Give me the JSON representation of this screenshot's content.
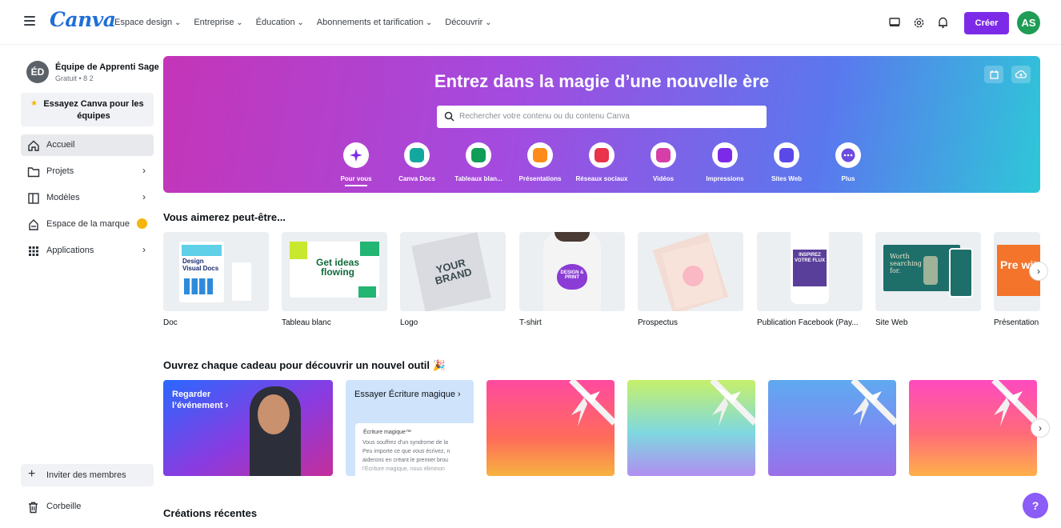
{
  "topbar": {
    "logo": "Canva",
    "nav": [
      "Espace design",
      "Entreprise",
      "Éducation",
      "Abonnements et tarification",
      "Découvrir"
    ],
    "create_label": "Créer",
    "avatar_initials": "AS",
    "icons": [
      "monitor-icon",
      "gear-icon",
      "bell-icon"
    ]
  },
  "sidebar": {
    "team_initials": "ÉD",
    "team_name": "Équipe de Apprenti Sage",
    "team_sub": "Gratuit • 8 2",
    "try_text": "Essayez Canva pour les équipes",
    "items": [
      {
        "label": "Accueil"
      },
      {
        "label": "Projets"
      },
      {
        "label": "Modèles"
      },
      {
        "label": "Espace de la marque"
      },
      {
        "label": "Applications"
      }
    ],
    "invite_label": "Inviter des membres",
    "trash_label": "Corbeille"
  },
  "hero": {
    "title": "Entrez dans la magie d’une nouvelle ère",
    "search_placeholder": "Rechercher votre contenu ou du contenu Canva",
    "categories": [
      {
        "label": "Pour vous",
        "color": "#7d2ae8"
      },
      {
        "label": "Canva Docs",
        "color": "#13a89e"
      },
      {
        "label": "Tableaux blan...",
        "color": "#0f9d58"
      },
      {
        "label": "Présentations",
        "color": "#ff8c1a"
      },
      {
        "label": "Réseaux sociaux",
        "color": "#e8334a"
      },
      {
        "label": "Vidéos",
        "color": "#d63fa7"
      },
      {
        "label": "Impressions",
        "color": "#7d2ae8"
      },
      {
        "label": "Sites Web",
        "color": "#5b48e8"
      },
      {
        "label": "Plus",
        "color": "#6a4ce0"
      }
    ]
  },
  "suggestions": {
    "title": "Vous aimerez peut-être...",
    "items": [
      {
        "label": "Doc"
      },
      {
        "label": "Tableau blanc"
      },
      {
        "label": "Logo"
      },
      {
        "label": "T-shirt"
      },
      {
        "label": "Prospectus"
      },
      {
        "label": "Publication Facebook (Pay..."
      },
      {
        "label": "Site Web"
      },
      {
        "label": "Présentation"
      }
    ],
    "doc_thumb_text": "Design Visual Docs",
    "wb_thumb_text": "Get ideas flowing",
    "logo_thumb_text": "YOUR BRAND",
    "tshirt_thumb_text": "DESIGN & PRINT",
    "fb_thumb_text": "INSPIREZ VOTRE FLUX",
    "site_thumb_text": "Worth searching for.",
    "pres_thumb_text": "Pre wit"
  },
  "gifts": {
    "title": "Ouvrez chaque cadeau pour découvrir un nouvel outil 🎉",
    "event_label": "Regarder l’événement ›",
    "magic_title": "Essayer Écriture magique ›",
    "magic_tag": "Écriture magique™",
    "magic_lines": [
      "Vous souffrez d'un syndrome de la",
      "Peu importe ce que vous écrivez, n",
      "aiderons en créant le premier brou",
      "l'Écriture magique, nous éliminon"
    ]
  },
  "recent": {
    "title": "Créations récentes"
  },
  "help_label": "?"
}
